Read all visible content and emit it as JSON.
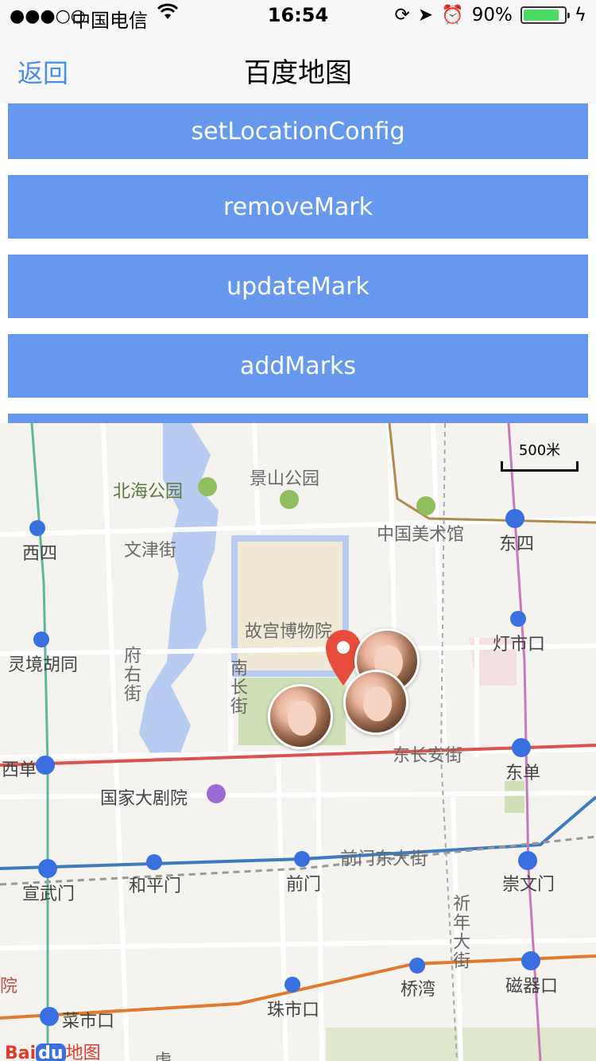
{
  "status_bar": {
    "signal": "●●●○○",
    "carrier": "中国电信",
    "wifi_icon": "wifi-icon",
    "time": "16:54",
    "battery_percent": "90%",
    "battery_level": 0.9
  },
  "nav": {
    "back_label": "返回",
    "title": "百度地图"
  },
  "buttons": [
    {
      "label": "setLocationConfig"
    },
    {
      "label": "removeMark"
    },
    {
      "label": "updateMark"
    },
    {
      "label": "addMarks"
    }
  ],
  "map": {
    "scale_label": "500米",
    "labels": {
      "beihai": "北海公园",
      "jingshan": "景山公园",
      "meishuguan": "中国美术馆",
      "dongsi": "东四",
      "xisi": "西四",
      "wenjin": "文津街",
      "gugong": "故宫博物院",
      "dengshikou": "灯市口",
      "lingjing": "灵境胡同",
      "fuyou": "府右街",
      "nanchang": "南长街",
      "xidan": "西单",
      "dongchangan": "东长安街",
      "dongdan": "东单",
      "dajuyuan": "国家大剧院",
      "qianmendong": "前门东大街",
      "xuanwumen": "宣武门",
      "hepingmen": "和平门",
      "qianmen": "前门",
      "chongwenmen": "崇文门",
      "xinnian": "祈年大街",
      "qiaowan": "桥湾",
      "ciqikou": "磁器口",
      "zhushikou": "珠市口",
      "caishikou": "菜市口",
      "yuan": "院",
      "hu": "虎"
    },
    "logo": {
      "bai": "Bai",
      "du": "du",
      "map": "地图"
    }
  }
}
